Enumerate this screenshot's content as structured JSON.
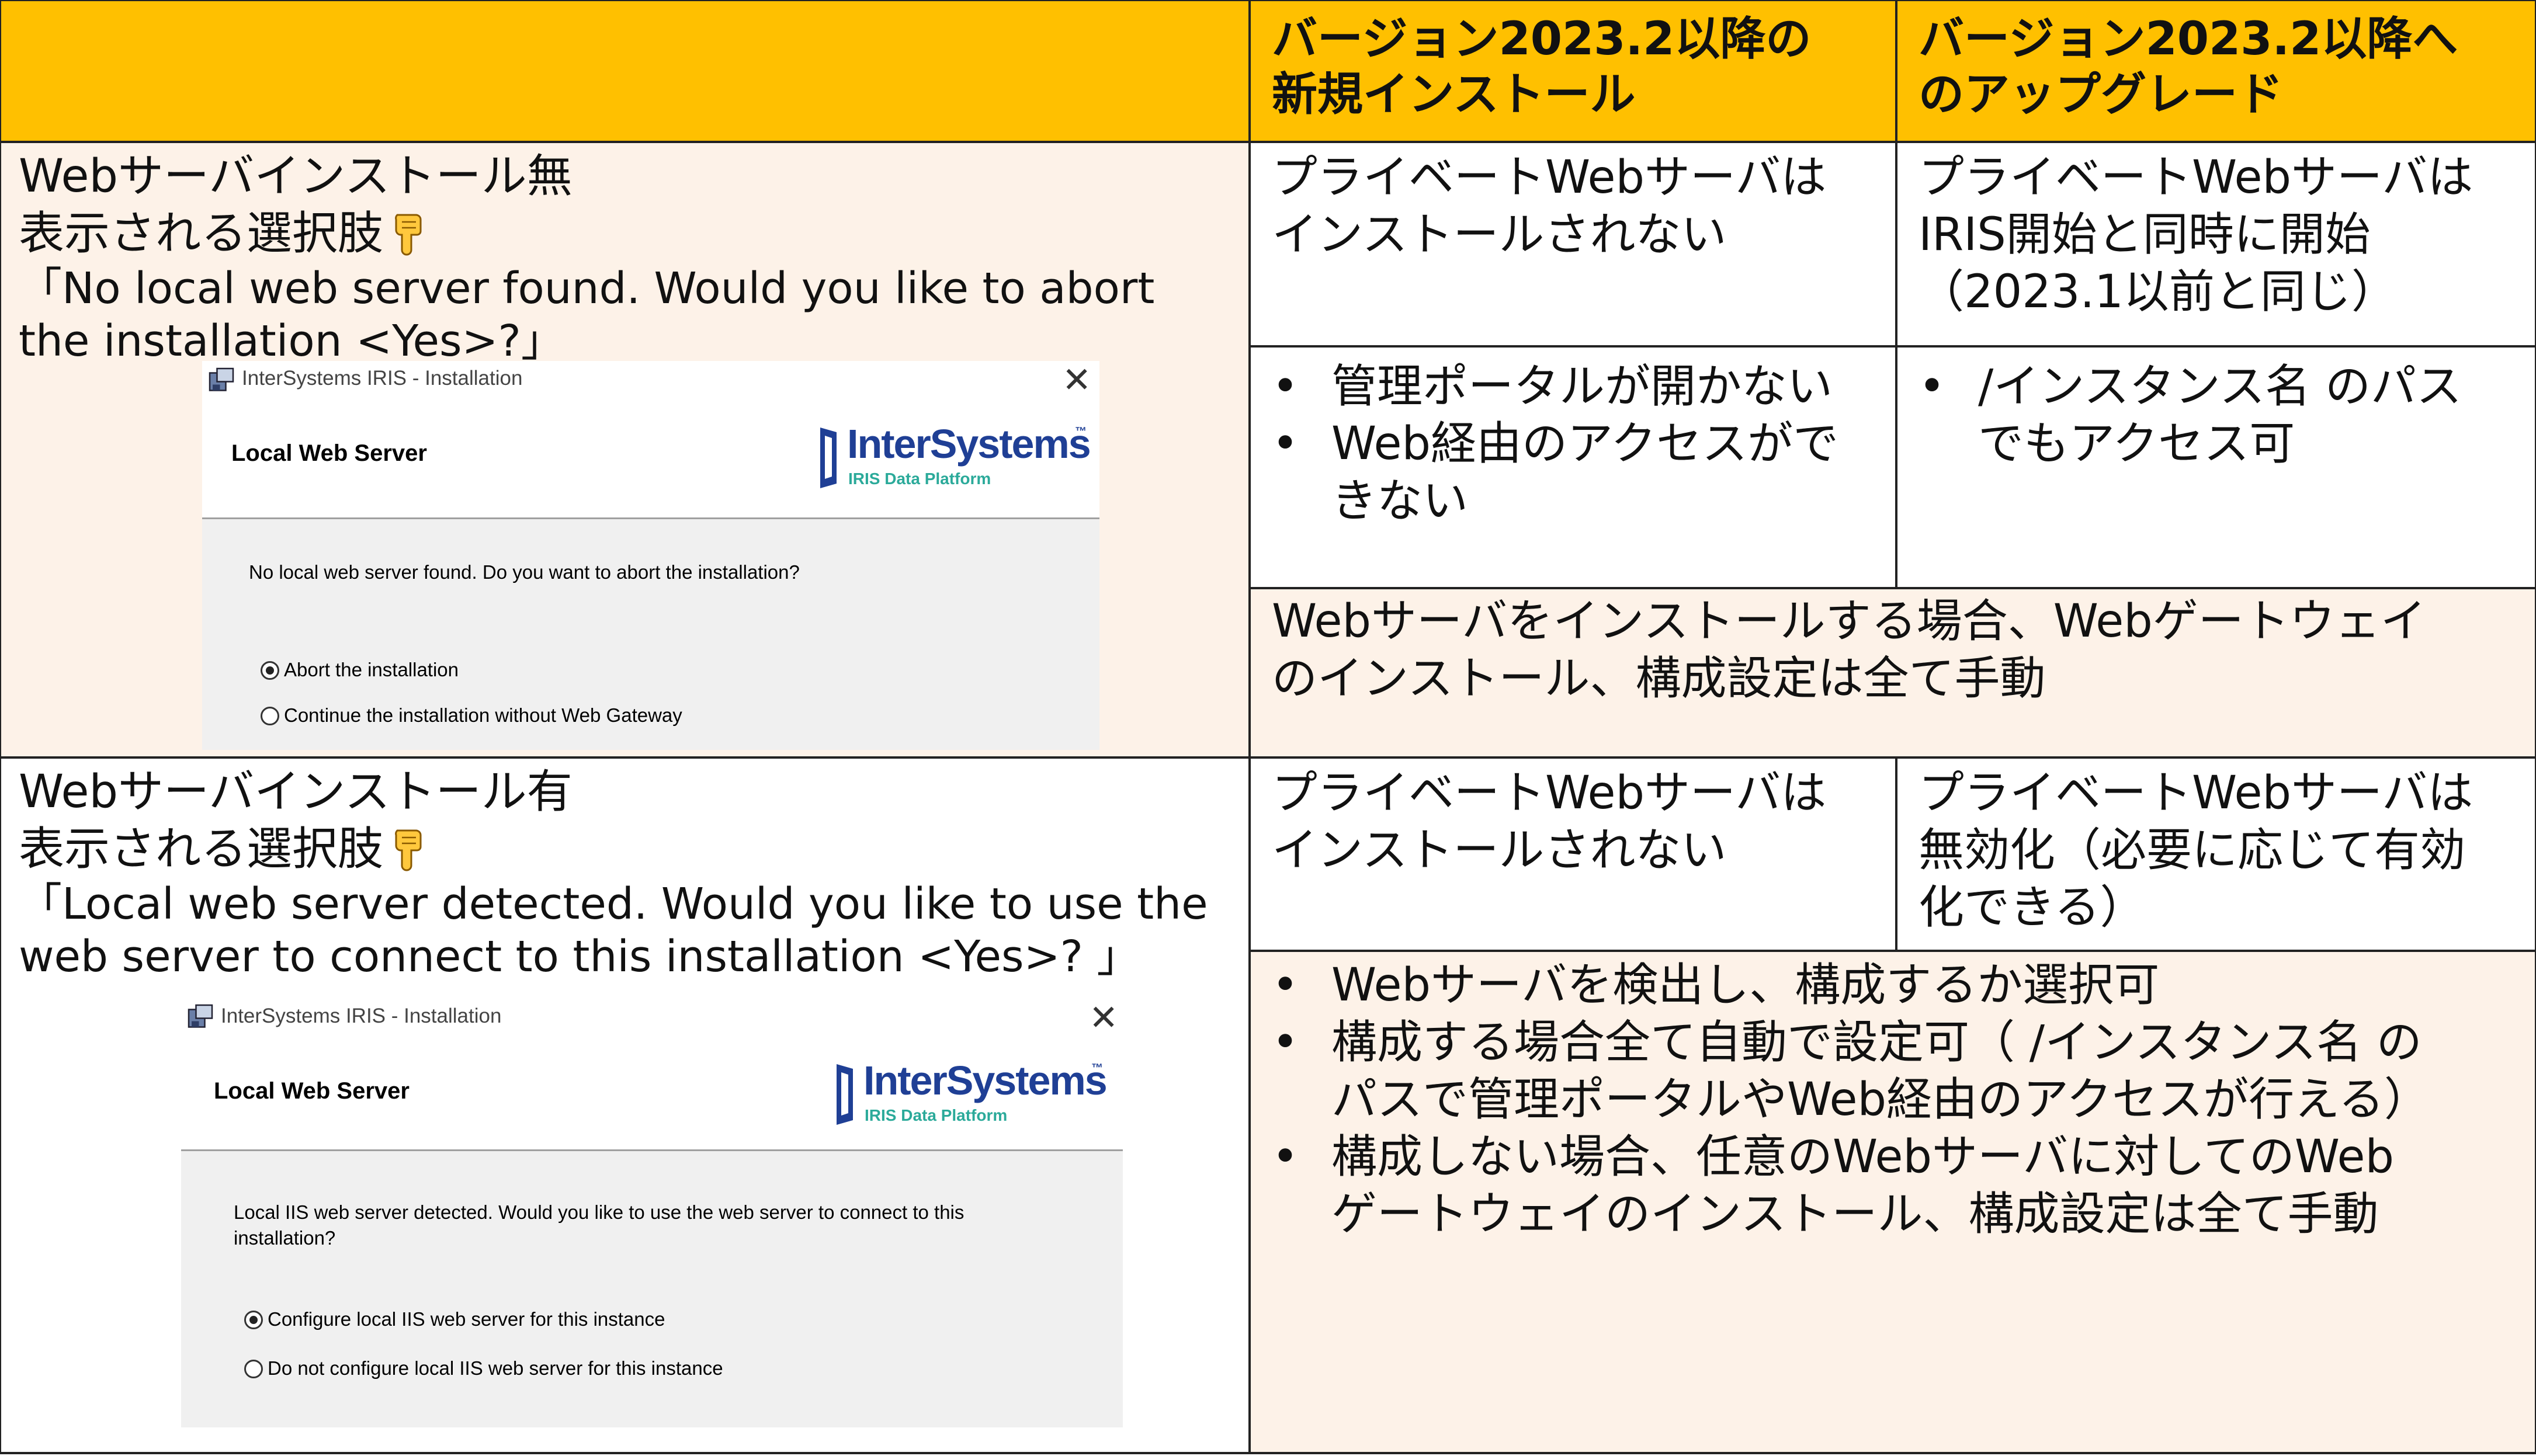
{
  "header": {
    "col1": "",
    "col2_line1": "バージョン2023.2以降の",
    "col2_line2": "新規インストール",
    "col3_line1": "バージョン2023.2以降へ",
    "col3_line2": "のアップグレード"
  },
  "row1": {
    "title": "Webサーバインストール無",
    "choices": "表示される選択肢",
    "prompt_line1": "「No local web server found. Would you like to abort",
    "prompt_line2": "the installation <Yes>?」",
    "new_install_line1": "プライベートWebサーバは",
    "new_install_line2": "インストールされない",
    "upgrade_line1": "プライベートWebサーバは",
    "upgrade_line2": "IRIS開始と同時に開始",
    "upgrade_line3": "（2023.1以前と同じ）",
    "new_bullets": [
      "管理ポータルが開かない",
      "Web経由のアクセスがで",
      "きない"
    ],
    "upgrade_bullets": [
      "/インスタンス名 のパス",
      "でもアクセス可"
    ],
    "merged_line1": "Webサーバをインストールする場合、Webゲートウェイ",
    "merged_line2": "のインストール、構成設定は全て手動"
  },
  "row2": {
    "title": "Webサーバインストール有",
    "choices": "表示される選択肢",
    "prompt_line1": "「Local web server detected. Would you like to use the",
    "prompt_line2": "web server to connect to this installation <Yes>? 」",
    "new_install_line1": "プライベートWebサーバは",
    "new_install_line2": "インストールされない",
    "upgrade_line1": "プライベートWebサーバは",
    "upgrade_line2": "無効化（必要に応じて有効",
    "upgrade_line3": "化できる）",
    "merged_bullets": [
      "Webサーバを検出し、構成するか選択可",
      "構成する場合全て自動で設定可（ /インスタンス名 の",
      "パスで管理ポータルやWeb経由のアクセスが行える）",
      "構成しない場合、任意のWebサーバに対してのWeb",
      "ゲートウェイのインストール、構成設定は全て手動"
    ]
  },
  "dialog1": {
    "window_title": "InterSystems IRIS - Installation",
    "close": "✕",
    "heading": "Local Web Server",
    "logo_name": "InterSystems",
    "logo_tm": "™",
    "logo_sub": "IRIS Data Platform",
    "message": "No local web server found. Do you want to abort the installation?",
    "option1": "Abort the installation",
    "option2": "Continue the installation without Web Gateway",
    "selected": "option1"
  },
  "dialog2": {
    "window_title": "InterSystems IRIS - Installation",
    "close": "✕",
    "heading": "Local Web Server",
    "logo_name": "InterSystems",
    "logo_tm": "™",
    "logo_sub": "IRIS Data Platform",
    "message_line1": "Local IIS web server detected. Would you like to use the web server to connect to this",
    "message_line2": "installation?",
    "option1": "Configure local IIS web server for this instance",
    "option2": "Do not configure local IIS web server for this instance",
    "selected": "option1"
  },
  "colors": {
    "header_bg": "#FFC000",
    "peach_bg": "#FDF2E8",
    "logo_blue": "#1F3F95",
    "logo_teal": "#2BAA9A"
  },
  "icons": [
    "pointing-down-hand-icon",
    "installer-app-icon",
    "close-icon",
    "intersystems-logo-icon",
    "radio-button-icon"
  ]
}
